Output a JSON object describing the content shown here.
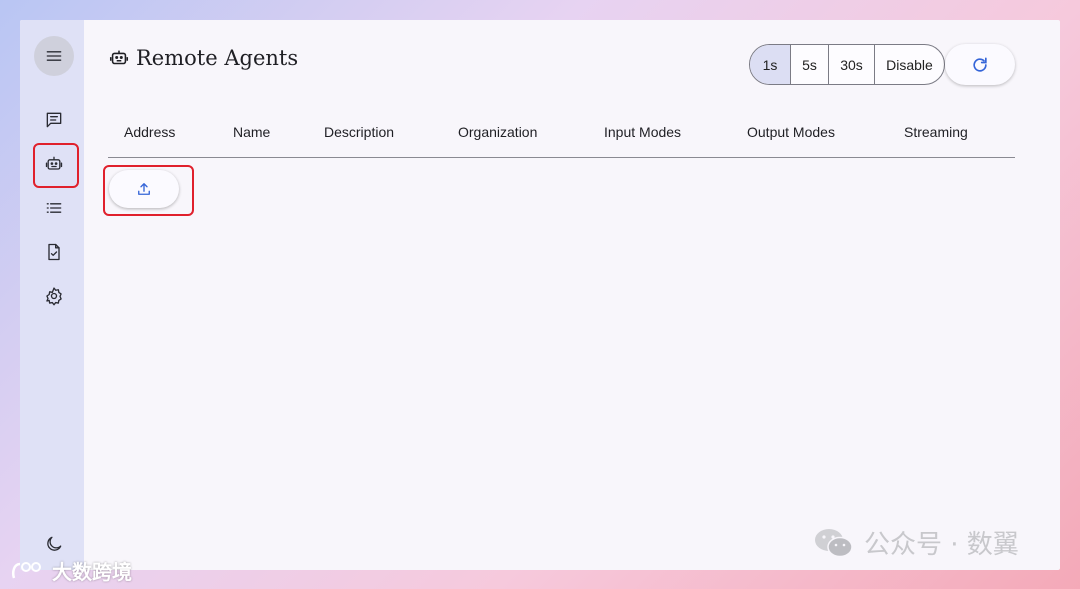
{
  "header": {
    "title": "Remote Agents"
  },
  "refresh_intervals": [
    "1s",
    "5s",
    "30s",
    "Disable"
  ],
  "selected_interval": "1s",
  "table": {
    "columns": [
      "Address",
      "Name",
      "Description",
      "Organization",
      "Input Modes",
      "Output Modes",
      "Streaming"
    ]
  },
  "sidebar": {
    "items": [
      "menu-icon",
      "chat-icon",
      "robot-icon",
      "list-icon",
      "task-icon",
      "settings-icon",
      "dark-mode-icon"
    ],
    "active": "robot-icon"
  },
  "watermark": {
    "text": "公众号 · 数翼",
    "bottom_text": "大数跨境"
  },
  "colors": {
    "accent": "#3565d8",
    "highlight": "#e0202c",
    "rail": "#dfe1f6",
    "selected_segment": "#dcdef3"
  }
}
